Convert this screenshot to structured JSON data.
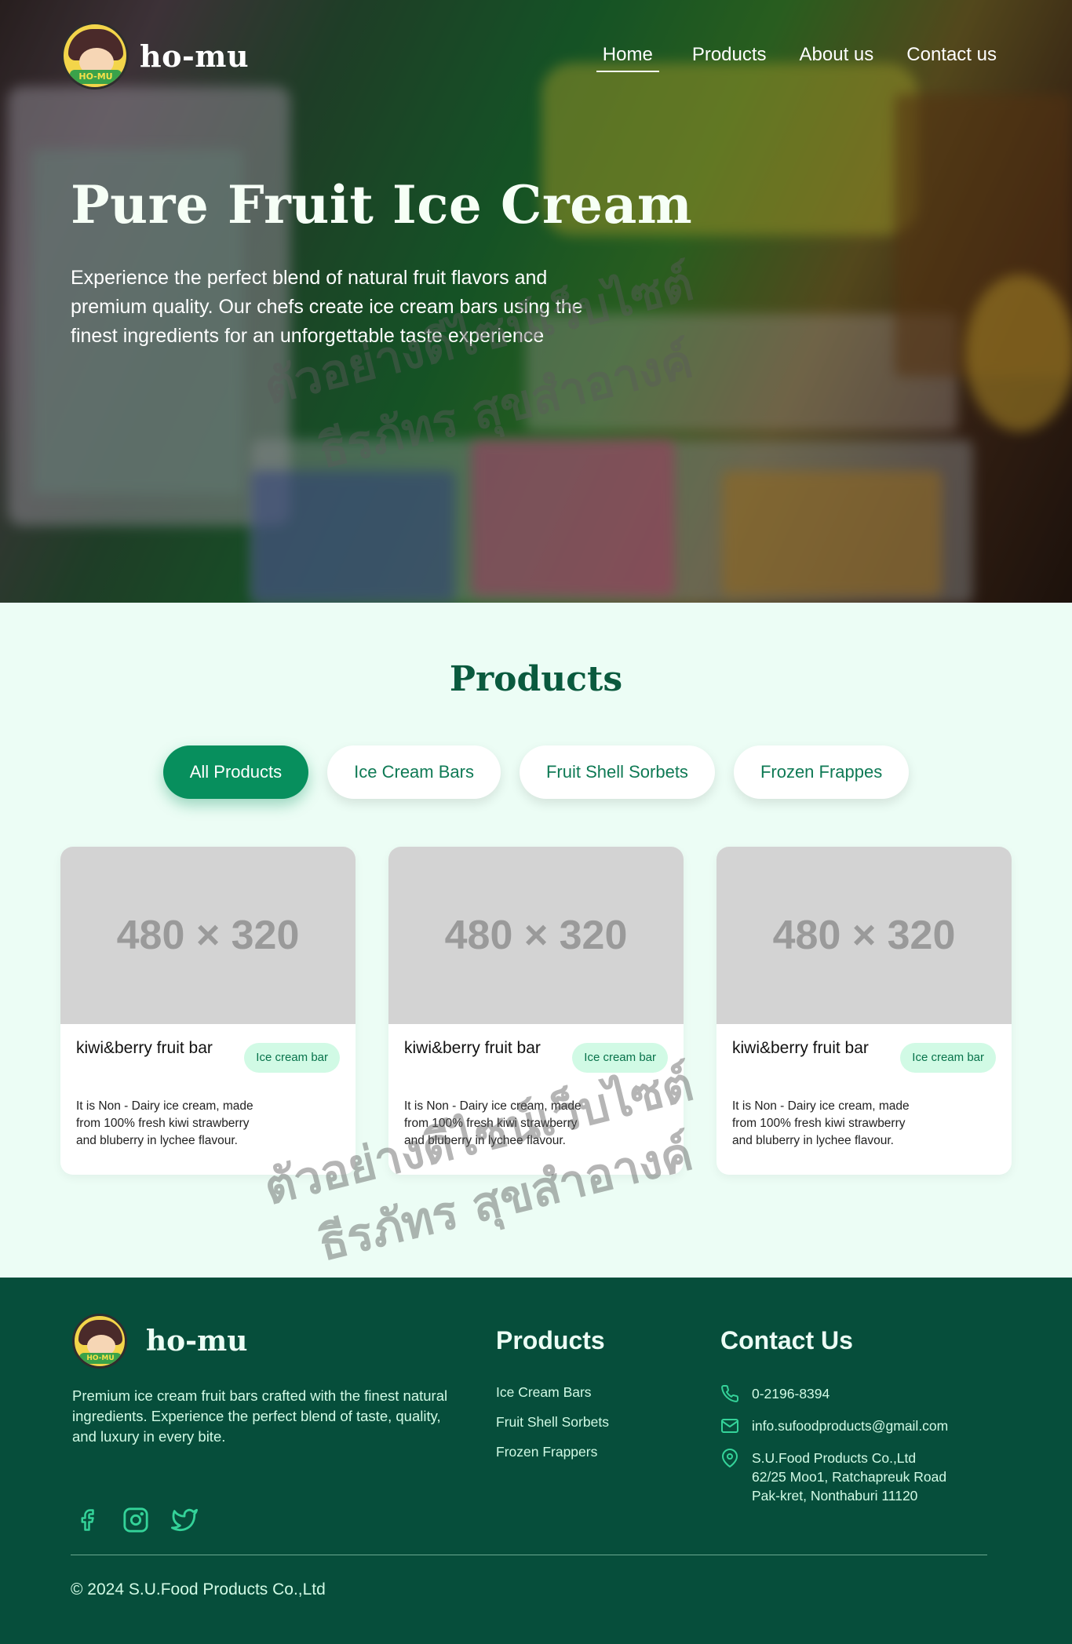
{
  "brand": {
    "name": "ho-mu",
    "logo_text": "HO-MU"
  },
  "nav": {
    "items": [
      {
        "label": "Home",
        "active": true
      },
      {
        "label": "Products",
        "active": false
      },
      {
        "label": "About us",
        "active": false
      },
      {
        "label": "Contact us",
        "active": false
      }
    ]
  },
  "hero": {
    "title": "Pure Fruit Ice Cream",
    "text": "Experience the perfect blend of natural fruit flavors and premium quality. Our chefs create ice cream bars using the finest ingredients for an unforgettable taste experience"
  },
  "watermark": {
    "line1": "ตัวอย่างดีไซน์เว็บไซต์",
    "line2": "ธีรภัทร สุขสำอางค์"
  },
  "products": {
    "title": "Products",
    "filters": [
      {
        "label": "All Products",
        "active": true
      },
      {
        "label": "Ice Cream Bars",
        "active": false
      },
      {
        "label": "Fruit Shell Sorbets",
        "active": false
      },
      {
        "label": "Frozen Frappes",
        "active": false
      }
    ],
    "cards": [
      {
        "image_text": "480 × 320",
        "name": "kiwi&berry fruit bar",
        "badge": "Ice cream bar",
        "description": "It is Non - Dairy ice cream, made from 100% fresh kiwi strawberry and bluberry in lychee flavour."
      },
      {
        "image_text": "480 × 320",
        "name": "kiwi&berry fruit bar",
        "badge": "Ice cream bar",
        "description": "It is Non - Dairy ice cream, made from 100% fresh kiwi strawberry and bluberry in lychee flavour."
      },
      {
        "image_text": "480 × 320",
        "name": "kiwi&berry fruit bar",
        "badge": "Ice cream bar",
        "description": "It is Non - Dairy ice cream, made from 100% fresh kiwi strawberry and bluberry in lychee flavour."
      }
    ]
  },
  "footer": {
    "brand_name": "ho-mu",
    "description": "Premium ice cream fruit bars crafted with the finest natural ingredients. Experience the perfect blend of taste, quality, and luxury in every bite.",
    "socials": [
      "facebook-icon",
      "instagram-icon",
      "twitter-icon"
    ],
    "products_title": "Products",
    "product_links": [
      "Ice Cream Bars",
      "Fruit Shell Sorbets",
      "Frozen Frappers"
    ],
    "contact_title": "Contact Us",
    "phone": "0-2196-8394",
    "email": "info.sufoodproducts@gmail.com",
    "address": [
      "S.U.Food Products Co.,Ltd",
      "62/25 Moo1, Ratchapreuk Road",
      "Pak-kret, Nonthaburi 11120"
    ],
    "copyright": "© 2024 S.U.Food Products Co.,Ltd"
  },
  "colors": {
    "primary": "#078f5d",
    "footer_bg": "#064e3b",
    "section_bg": "#ecfdf5",
    "badge_bg": "#d1fae5"
  }
}
